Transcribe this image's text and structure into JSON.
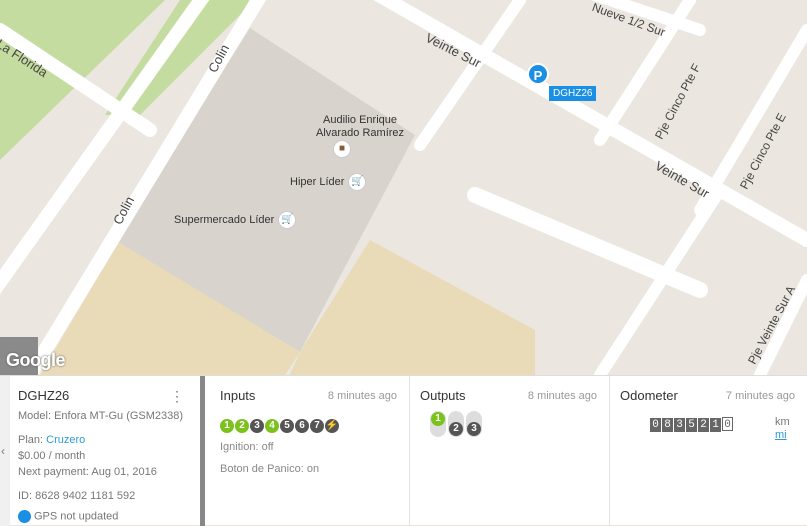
{
  "map": {
    "streets": {
      "la_florida": "La Florida",
      "colin_top": "Colin",
      "colin_mid": "Colin",
      "colin_bottom": "Colin",
      "veinte_sur_top": "Veinte Sur",
      "veinte_sur_mid": "Veinte Sur",
      "nueve_medio_sur": "Nueve 1/2 Sur",
      "pje_cinco_pte_f": "Pje Cinco Pte F",
      "pje_cinco_pte_e": "Pje Cinco Pte E",
      "pje_veinte_sur_a": "Pje Veinte Sur A"
    },
    "pois": {
      "audilio_line1": "Audilio Enrique",
      "audilio_line2": "Alvarado Ramírez",
      "hiper_lider": "Hiper Líder",
      "supermercado_lider": "Supermercado Líder"
    },
    "marker_letter": "P",
    "marker_label": "DGHZ26",
    "logo": "Google",
    "colors": {
      "marker": "#1a8fe3",
      "park": "#c5dca0",
      "lot": "#e9dbb7",
      "building": "#d8d3cd"
    }
  },
  "device": {
    "name": "DGHZ26",
    "model": "Model: Enfora MT-Gu (GSM2338)",
    "plan_label": "Plan: ",
    "plan_name": "Cruzero",
    "price": "$0.00 / month",
    "next_payment": "Next payment: Aug 01, 2016",
    "id": "ID: 8628 9402 1181 592",
    "gps_status": "GPS not updated"
  },
  "inputs": {
    "title": "Inputs",
    "time": "8 minutes ago",
    "badges": [
      {
        "label": "1",
        "on": true
      },
      {
        "label": "2",
        "on": true
      },
      {
        "label": "3",
        "on": false
      },
      {
        "label": "4",
        "on": true
      },
      {
        "label": "5",
        "on": false
      },
      {
        "label": "6",
        "on": false
      },
      {
        "label": "7",
        "on": false
      },
      {
        "label": "⚡",
        "on": false
      }
    ],
    "ignition": "Ignition: off",
    "panic": "Boton de Panico: on"
  },
  "outputs": {
    "title": "Outputs",
    "time": "8 minutes ago",
    "items": [
      {
        "label": "1",
        "on": true
      },
      {
        "label": "2",
        "on": false
      },
      {
        "label": "3",
        "on": false
      }
    ]
  },
  "odometer": {
    "title": "Odometer",
    "time": "7 minutes ago",
    "digits": [
      "0",
      "8",
      "3",
      "5",
      "2",
      "1",
      "0"
    ],
    "unit_km": "km",
    "unit_mi": "mi"
  }
}
